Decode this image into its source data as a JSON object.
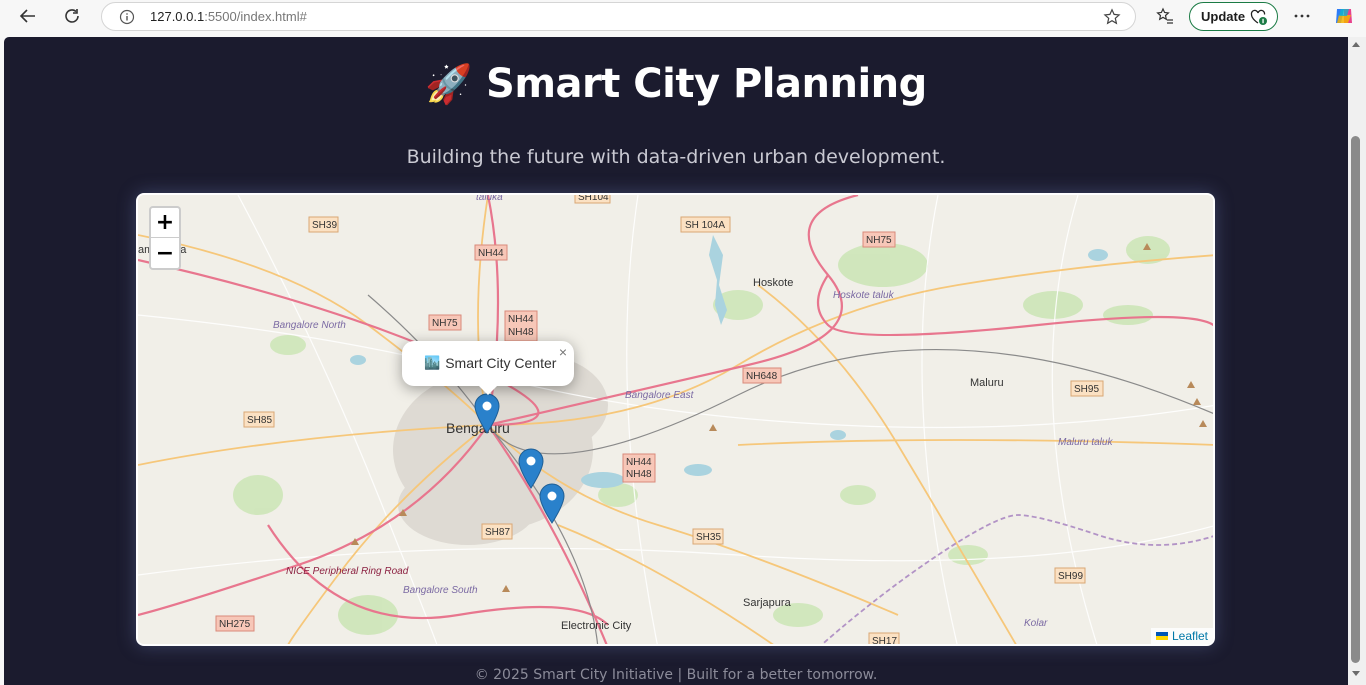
{
  "browser": {
    "url_host": "127.0.0.1",
    "url_rest": ":5500/index.html#",
    "update_label": "Update"
  },
  "page": {
    "title_emoji": "🚀",
    "title": "Smart City Planning",
    "subtitle": "Building the future with data-driven urban development.",
    "footer": "© 2025 Smart City Initiative | Built for a better tomorrow."
  },
  "map": {
    "zoom_in": "+",
    "zoom_out": "−",
    "popup_icon": "🏙️",
    "popup_text": "Smart City Center",
    "popup_close": "×",
    "attribution": "Leaflet",
    "markers": 3,
    "labels": {
      "bengaluru": "Bengaluru",
      "hoskote": "Hoskote",
      "maluru": "Maluru",
      "sarjapura": "Sarjapura",
      "electronic_city": "Electronic City",
      "bangalore_north": "Bangalore North",
      "bangalore_east": "Bangalore East",
      "bangalore_south": "Bangalore South",
      "hoskote_taluk": "Hoskote taluk",
      "maluru_taluk": "Maluru taluk",
      "kolar": "Kolar",
      "nice_road": "NICE Peripheral Ring Road",
      "namangala": "amangala",
      "taluka_top": "taluka"
    },
    "shields": {
      "sh39": "SH39",
      "sh104": "SH104",
      "sh104a": "SH 104A",
      "nh75_top": "NH75",
      "nh44_top": "NH44",
      "nh75_left": "NH75",
      "nh44_a": "NH44",
      "nh48_a": "NH48",
      "nh648": "NH648",
      "sh95": "SH95",
      "sh85": "SH85",
      "nh44_b": "NH44",
      "nh48_b": "NH48",
      "sh87": "SH87",
      "sh35": "SH35",
      "sh99": "SH99",
      "nh275": "NH275",
      "sh17": "SH17"
    }
  },
  "colors": {
    "page_bg": "#1b1b2e",
    "marker": "#2a81cb",
    "link": "#0078a8"
  }
}
